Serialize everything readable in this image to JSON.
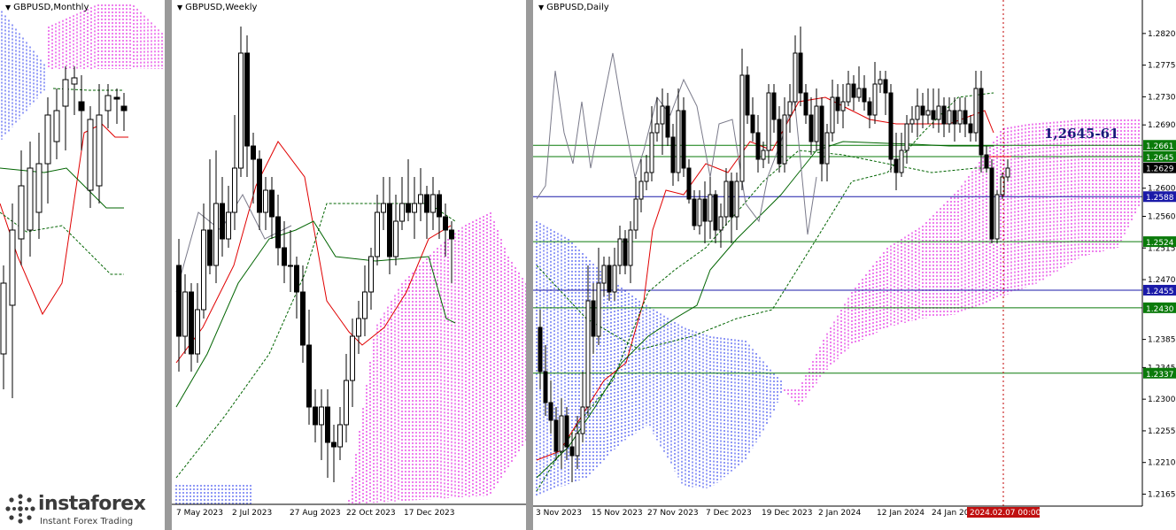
{
  "panels": {
    "monthly": {
      "title": "GBPUSD,Monthly",
      "xlabels": []
    },
    "weekly": {
      "title": "GBPUSD,Weekly",
      "xlabels": [
        "7 May 2023",
        "2 Jul 2023",
        "27 Aug 2023",
        "22 Oct 2023",
        "17 Dec 2023"
      ]
    },
    "daily": {
      "title": "GBPUSD,Daily",
      "xlabels": [
        "3 Nov 2023",
        "15 Nov 2023",
        "27 Nov 2023",
        "7 Dec 2023",
        "19 Dec 2023",
        "2 Jan 2024",
        "12 Jan 2024",
        "24 Jan 20"
      ],
      "date_tag": "2024.02.07 00:00",
      "annotation": "1,2645-61"
    }
  },
  "chart_data": {
    "type": "candlestick",
    "symbol": "GBPUSD",
    "daily_y_axis": {
      "ylim": [
        1.2153,
        1.285
      ],
      "ticks": [
        "1.2820",
        "1.2775",
        "1.2730",
        "1.2690",
        "1.2600",
        "1.2560",
        "1.2515",
        "1.2470",
        "1.2385",
        "1.2345",
        "1.2300",
        "1.2255",
        "1.2210",
        "1.2165"
      ],
      "tick_values": [
        1.282,
        1.2775,
        1.273,
        1.269,
        1.26,
        1.256,
        1.2515,
        1.247,
        1.2385,
        1.2345,
        1.23,
        1.2255,
        1.221,
        1.2165
      ]
    },
    "levels": [
      {
        "label": "1.2661",
        "value": 1.2661,
        "color": "#0a7a0a"
      },
      {
        "label": "1.2645",
        "value": 1.2645,
        "color": "#0a7a0a"
      },
      {
        "label": "1.2629",
        "value": 1.2629,
        "color": "#000000"
      },
      {
        "label": "1.2588",
        "value": 1.2588,
        "color": "#1a1aa8"
      },
      {
        "label": "1.2524",
        "value": 1.2524,
        "color": "#0a7a0a"
      },
      {
        "label": "1.2455",
        "value": 1.2455,
        "color": "#1a1aa8"
      },
      {
        "label": "1.2430",
        "value": 1.243,
        "color": "#0a7a0a"
      },
      {
        "label": "1.2337",
        "value": 1.2337,
        "color": "#0a7a0a"
      }
    ]
  },
  "logo": {
    "brand": "instaforex",
    "tagline": "Instant Forex Trading"
  },
  "colors": {
    "bull": "#ffffff",
    "bear": "#000000",
    "kijun": "#006400",
    "tenkan": "#e00000",
    "cloud_up": "#dd00dd",
    "cloud_down": "#2233ee",
    "chikou": "#7a7a8a"
  }
}
